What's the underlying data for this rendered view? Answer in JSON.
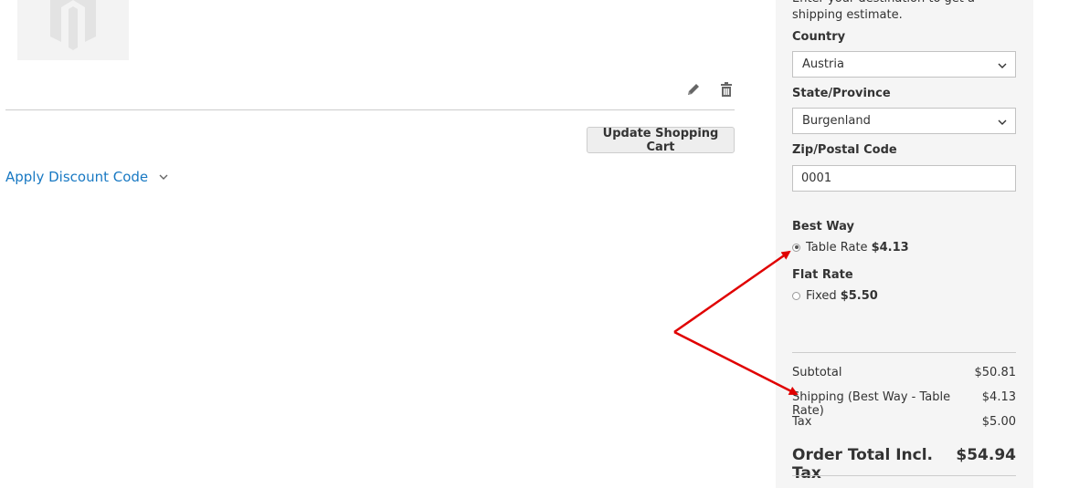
{
  "cart": {
    "update_button": "Update Shopping Cart",
    "discount_label": "Apply Discount Code"
  },
  "summary": {
    "intro_text": "Enter your destination to get a shipping estimate.",
    "country_label": "Country",
    "country_value": "Austria",
    "state_label": "State/Province",
    "state_value": "Burgenland",
    "zip_label": "Zip/Postal Code",
    "zip_value": "0001",
    "carriers": [
      {
        "title": "Best Way",
        "method": "Table Rate",
        "price": "$4.13",
        "selected": true
      },
      {
        "title": "Flat Rate",
        "method": "Fixed",
        "price": "$5.50",
        "selected": false
      }
    ],
    "totals": [
      {
        "label": "Subtotal",
        "value": "$50.81"
      },
      {
        "label": "Shipping (Best Way - Table Rate)",
        "value": "$4.13"
      },
      {
        "label": "Tax",
        "value": "$5.00"
      }
    ],
    "grand_total": {
      "label": "Order Total Incl. Tax",
      "value": "$54.94"
    }
  },
  "colors": {
    "link": "#1979c3",
    "panel_bg": "#f5f5f5",
    "annotation": "#e00000"
  },
  "icons": [
    "pencil-icon",
    "trash-icon",
    "chevron-down-icon"
  ]
}
